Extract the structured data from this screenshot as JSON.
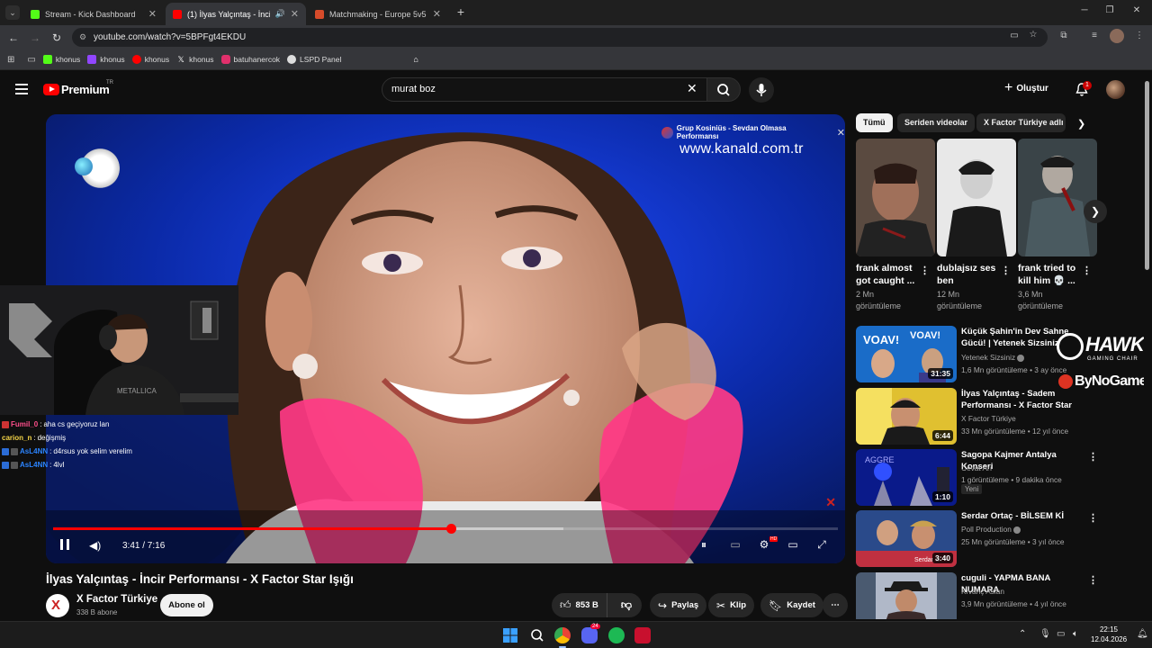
{
  "browser": {
    "tabs": [
      {
        "title": "Stream - Kick Dashboard",
        "favicon_color": "#53fc18",
        "active": false
      },
      {
        "title": "(1) İlyas Yalçıntaş - İncir Perf",
        "favicon_color": "#ff0000",
        "active": true
      },
      {
        "title": "Matchmaking - Europe 5v5 Qu",
        "favicon_color": "#d64b2a",
        "active": false
      }
    ],
    "url": "youtube.com/watch?v=5BPFgt4EKDU",
    "bookmarks": [
      {
        "label": "khonus",
        "color": "#53fc18"
      },
      {
        "label": "khonus",
        "color": "#9146ff"
      },
      {
        "label": "khonus",
        "color": "#ff0000"
      },
      {
        "label": "khonus",
        "color": "#ffffff"
      },
      {
        "label": "batuhanercok",
        "color": "#e1306c"
      },
      {
        "label": "LSPD Panel",
        "color": "#ffffff"
      }
    ]
  },
  "youtube": {
    "brand": "Premium",
    "country": "TR",
    "search_query": "murat boz",
    "create_label": "Oluştur",
    "notification_count": "1"
  },
  "player": {
    "overlay_title": "Grup Kosiniüs - Sevdan Olmasa Performansı",
    "watermark_url": "www.kanald.com.tr",
    "time": "3:41 / 7:16",
    "progress": 0.507,
    "buffered": 0.65
  },
  "stream_chat": [
    {
      "user": "Fumil_0",
      "message": "aha cs geçiyoruz lan",
      "color": "#ff4f8b",
      "badge": false
    },
    {
      "user": "carion_n",
      "message": "değişmiş",
      "color": "#f5d547",
      "badge": false
    },
    {
      "user": "AsL4NN",
      "message": "d4rsus yok selim verelim",
      "color": "#2b84ff",
      "badge": true
    },
    {
      "user": "AsL4NN",
      "message": "4lvl",
      "color": "#2b84ff",
      "badge": true
    }
  ],
  "video": {
    "title": "İlyas Yalçıntaş - İncir Performansı - X Factor Star Işığı",
    "channel": "X Factor Türkiye",
    "subscribers": "338 B abone",
    "subscribe_label": "Abone ol",
    "likes": "853 B",
    "share_label": "Paylaş",
    "clip_label": "Klip",
    "save_label": "Kaydet"
  },
  "chips": [
    {
      "label": "Tümü",
      "active": true
    },
    {
      "label": "Seriden videolar",
      "active": false
    },
    {
      "label": "X Factor Türkiye adlı",
      "active": false
    }
  ],
  "shorts": [
    {
      "title": "frank almost got caught ...",
      "views": "2 Mn",
      "views_label": "görüntüleme"
    },
    {
      "title": "dublajsız ses ben Optimu...",
      "views": "12 Mn",
      "views_label": "görüntüleme"
    },
    {
      "title": "frank tried to kill him 💀 ...",
      "views": "3,6 Mn",
      "views_label": "görüntüleme"
    }
  ],
  "recommendations": [
    {
      "title": "Küçük Şahin'in Dev Sahne Gücü! | Yetenek Sizsiniz",
      "channel": "Yetenek Sizsiniz",
      "verified": true,
      "meta": "1,6 Mn görüntüleme • 3 ay önce",
      "duration": "31:35"
    },
    {
      "title": "İlyas Yalçıntaş - Sadem Performansı - X Factor Star Işığı",
      "channel": "X Factor Türkiye",
      "verified": false,
      "meta": "33 Mn görüntüleme • 12 yıl önce",
      "duration": "6:44"
    },
    {
      "title": "Sagopa Kajmer Antalya Konseri",
      "channel": "Cevat Arı",
      "verified": false,
      "meta": "1 görüntüleme • 9 dakika önce",
      "duration": "1:10",
      "badge": "Yeni"
    },
    {
      "title": "Serdar Ortaç - BİLSEM Kİ",
      "channel": "Poll Production",
      "verified": true,
      "meta": "25 Mn görüntüleme • 3 yıl önce",
      "duration": "3:40"
    },
    {
      "title": "cuguli - YAPMA BANA NUMARA",
      "channel": "Kıvanç Aslan",
      "verified": false,
      "meta": "3,9 Mn görüntüleme • 4 yıl önce",
      "duration": ""
    }
  ],
  "sponsor": {
    "brand1": "HAWK",
    "brand1_sub": "GAMING CHAIR",
    "brand2": "ByNoGame"
  },
  "taskbar": {
    "time": "22:15",
    "date": "12.04.2026",
    "discord_badge": "24"
  }
}
